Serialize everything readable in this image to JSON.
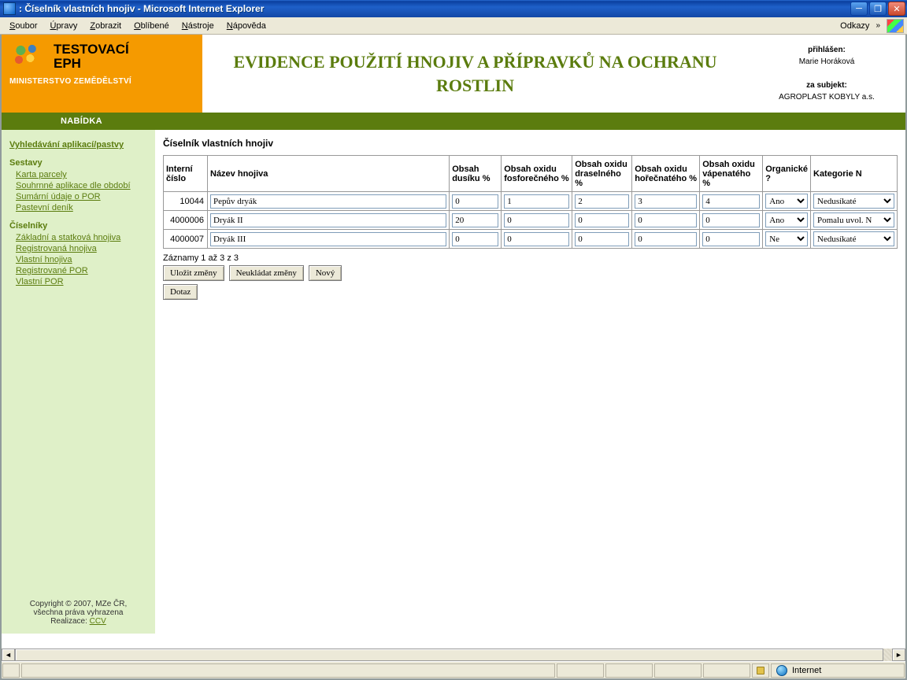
{
  "window": {
    "title": ": Číselník vlastních hnojiv - Microsoft Internet Explorer"
  },
  "menu": {
    "items": [
      "Soubor",
      "Úpravy",
      "Zobrazit",
      "Oblíbené",
      "Nástroje",
      "Nápověda"
    ],
    "odkazy": "Odkazy"
  },
  "header": {
    "logo_line1": "TESTOVACÍ",
    "logo_line2": "EPH",
    "logo_sub": "MINISTERSTVO ZEMĚDĚLSTVÍ",
    "app_title": "EVIDENCE POUŽITÍ HNOJIV A PŘÍPRAVKŮ NA OCHRANU ROSTLIN",
    "login_label": "přihlášen:",
    "login_name": "Marie Horáková",
    "subject_label": "za subjekt:",
    "subject_name": "AGROPLAST KOBYLY a.s."
  },
  "navbar": {
    "label": "NABÍDKA"
  },
  "sidebar": {
    "top_link": "Vyhledávání aplikací/pastvy",
    "section1_title": "Sestavy",
    "section1_links": [
      "Karta parcely",
      "Souhrnné aplikace dle období",
      "Sumární údaje o POR",
      "Pastevní deník"
    ],
    "section2_title": "Číselníky",
    "section2_links": [
      "Základní a statková hnojiva",
      "Registrovaná hnojiva",
      "Vlastní hnojiva",
      "Registrované POR",
      "Vlastní POR"
    ],
    "footer_line1": "Copyright © 2007, MZe ČR,",
    "footer_line2": "všechna práva vyhrazena",
    "footer_line3_prefix": "Realizace: ",
    "footer_link": "CCV"
  },
  "main": {
    "heading": "Číselník vlastních hnojiv",
    "columns": [
      "Interní číslo",
      "Název hnojiva",
      "Obsah dusíku %",
      "Obsah oxidu fosforečného %",
      "Obsah oxidu draselného %",
      "Obsah oxidu hořečnatého %",
      "Obsah oxidu vápenatého %",
      "Organické ?",
      "Kategorie N"
    ],
    "rows": [
      {
        "id": "10044",
        "name": "Pepův dryák",
        "n": "0",
        "p": "1",
        "k": "2",
        "mg": "3",
        "ca": "4",
        "organic": "Ano",
        "cat": "Nedusíkaté"
      },
      {
        "id": "4000006",
        "name": "Dryák II",
        "n": "20",
        "p": "0",
        "k": "0",
        "mg": "0",
        "ca": "0",
        "organic": "Ano",
        "cat": "Pomalu uvol. N"
      },
      {
        "id": "4000007",
        "name": "Dryák III",
        "n": "0",
        "p": "0",
        "k": "0",
        "mg": "0",
        "ca": "0",
        "organic": "Ne",
        "cat": "Nedusíkaté"
      }
    ],
    "organic_options": [
      "Ano",
      "Ne"
    ],
    "cat_options": [
      "Nedusíkaté",
      "Pomalu uvol. N"
    ],
    "record_info": "Záznamy 1 až 3 z 3",
    "btn_save": "Uložit změny",
    "btn_discard": "Neukládat změny",
    "btn_new": "Nový",
    "btn_query": "Dotaz"
  },
  "statusbar": {
    "zone": "Internet"
  }
}
